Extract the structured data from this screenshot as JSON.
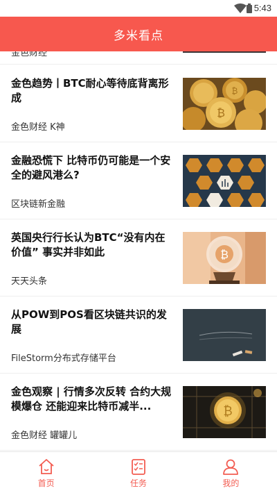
{
  "status_bar": {
    "time": "5:43",
    "icons": [
      "wifi-icon",
      "battery-icon"
    ]
  },
  "header": {
    "title": "多米看点"
  },
  "previous_item": {
    "source": "金色财经"
  },
  "articles": [
    {
      "headline": "金色趋势丨BTC耐心等待底背离形成",
      "source": "金色财经 K神",
      "thumbnail": "gold-bitcoin-coins"
    },
    {
      "headline": "金融恐慌下 比特币仍可能是一个安全的避风港么?",
      "source": "区块链新金融",
      "thumbnail": "hexagon-blockchain-pattern"
    },
    {
      "headline": "英国央行行长认为BTC“没有内在价值” 事实并非如此",
      "source": "天天头条",
      "thumbnail": "bitcoin-crystal-ball"
    },
    {
      "headline": "从POW到POS看区块链共识的发展",
      "source": "FileStorm分布式存储平台",
      "thumbnail": "blockchain-chalkboard"
    },
    {
      "headline": "金色观察 | 行情多次反转 合约大规模爆仓 还能迎来比特币减半...",
      "source": "金色财经 罐罐儿",
      "thumbnail": "bitcoin-circuit-board"
    }
  ],
  "tab_bar": {
    "tabs": [
      {
        "label": "首页",
        "icon": "home-icon"
      },
      {
        "label": "任务",
        "icon": "task-list-icon"
      },
      {
        "label": "我的",
        "icon": "profile-icon"
      }
    ]
  },
  "colors": {
    "accent": "#f7584e",
    "tab_label": "#f35c51",
    "divider": "#eeeeee"
  }
}
